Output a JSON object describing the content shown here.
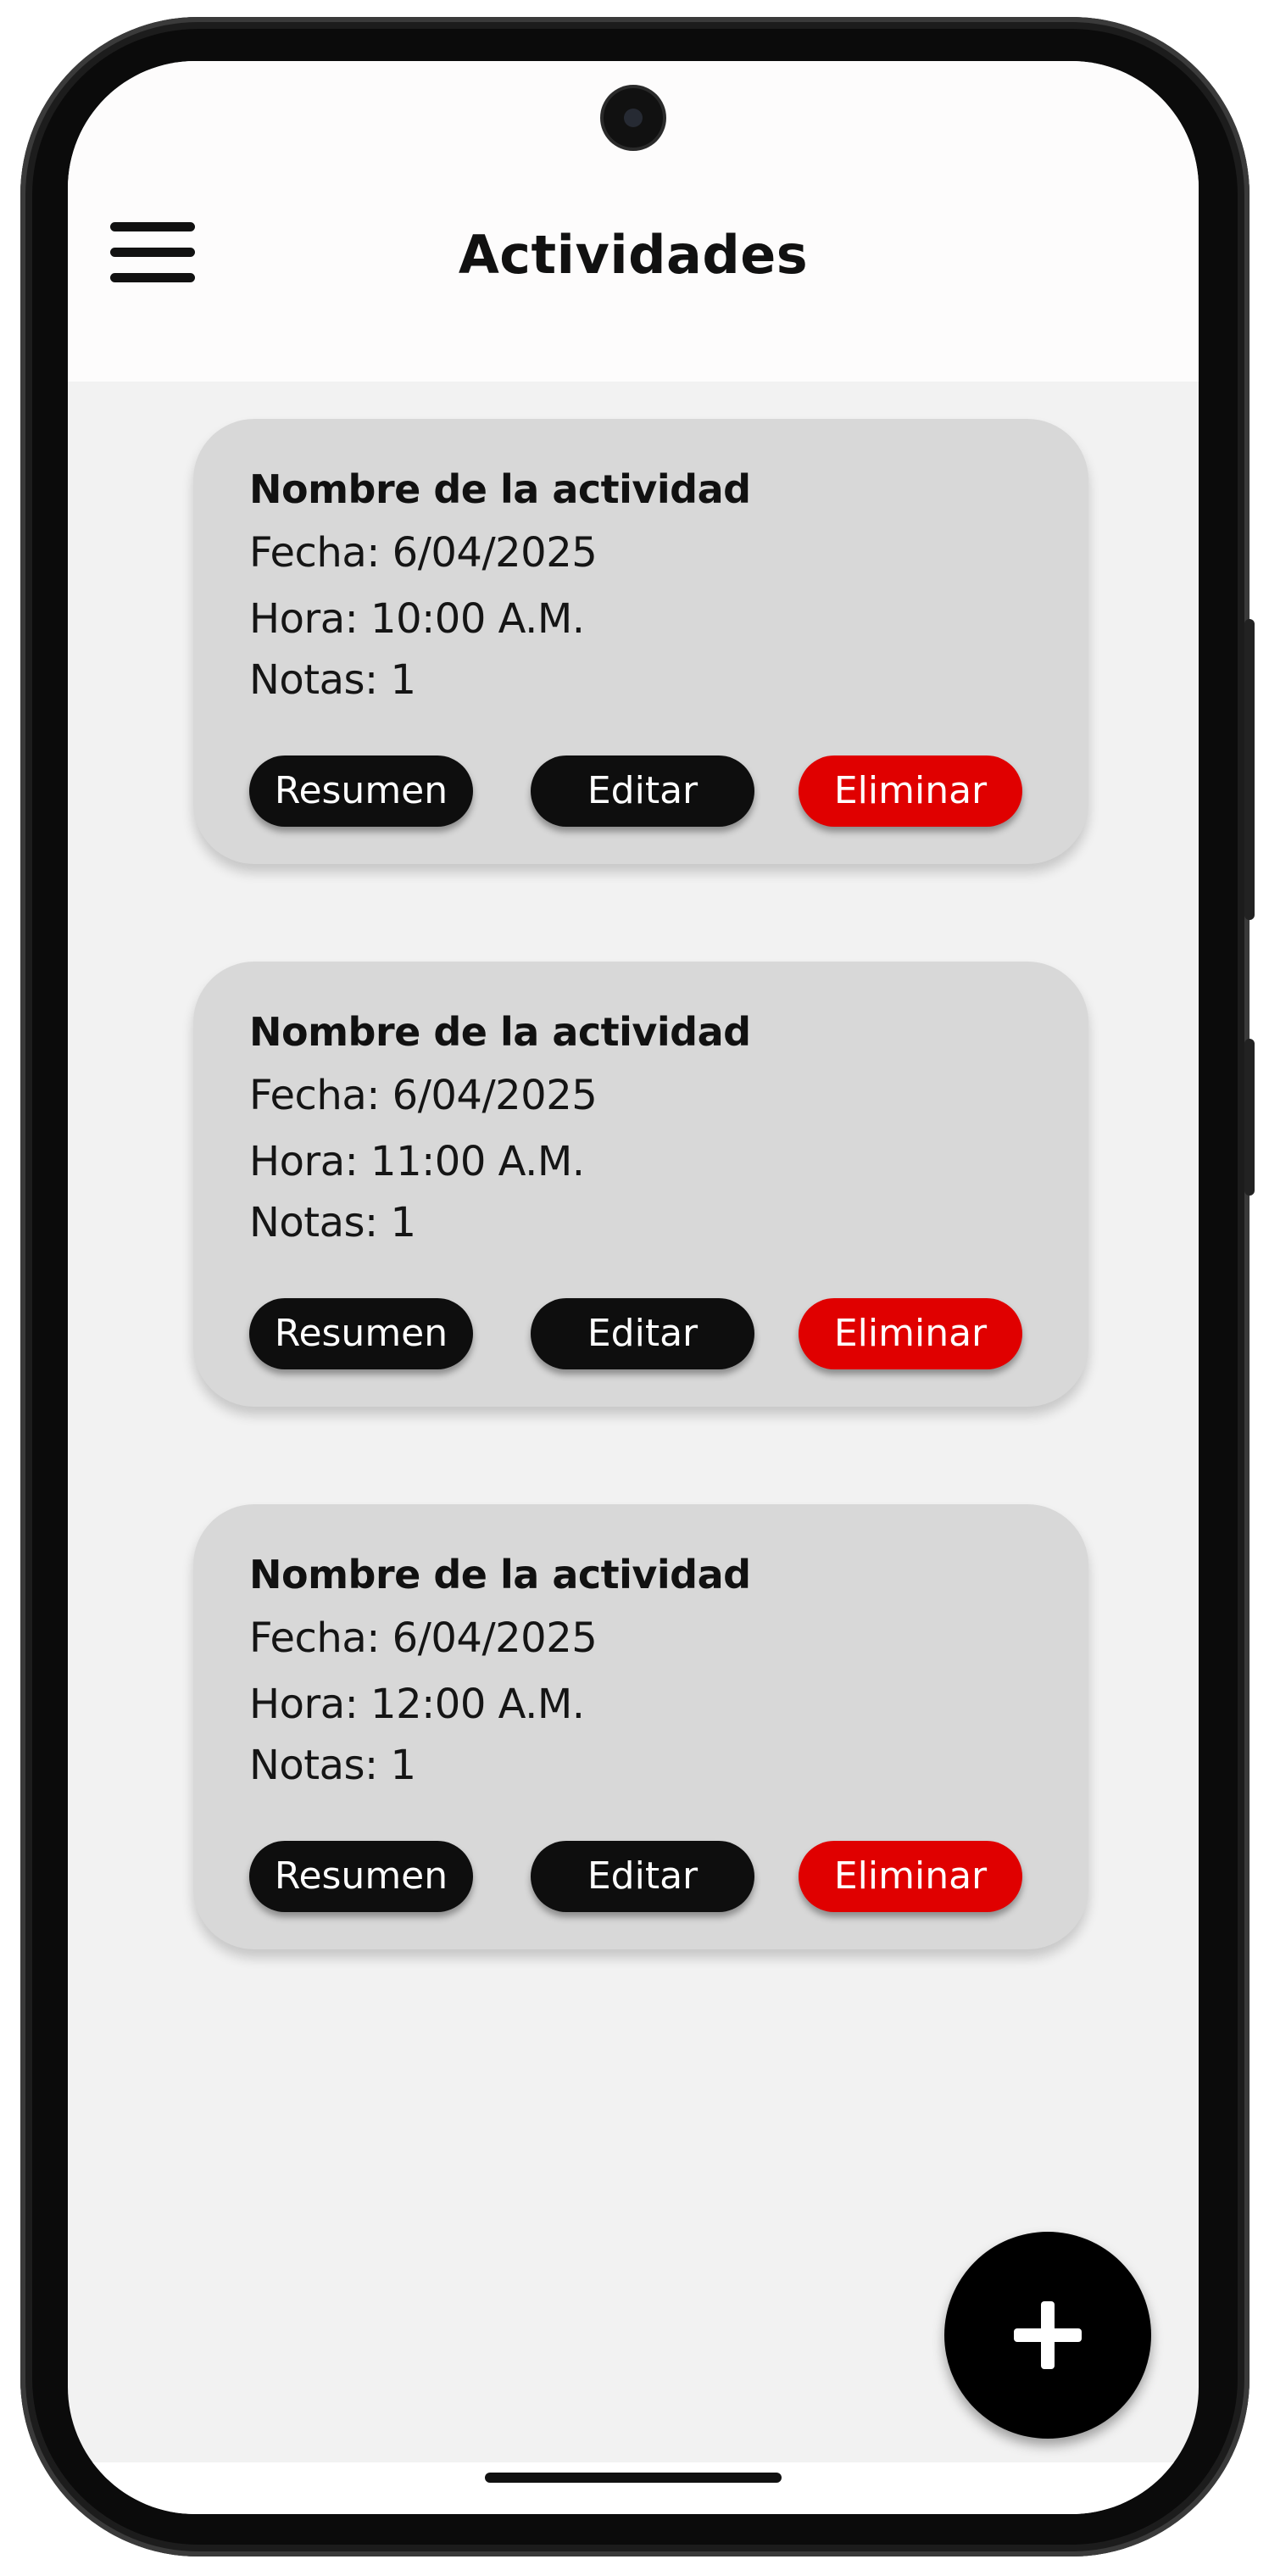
{
  "header": {
    "title": "Actividades",
    "menu_icon": "hamburger-menu-icon"
  },
  "activities": [
    {
      "name": "Nombre de la actividad",
      "date": "Fecha: 6/04/2025",
      "time": "Hora: 10:00 A.M.",
      "notes": "Notas: 1",
      "actions": {
        "summary": "Resumen",
        "edit": "Editar",
        "delete": "Eliminar"
      }
    },
    {
      "name": "Nombre de la actividad",
      "date": "Fecha: 6/04/2025",
      "time": "Hora: 11:00 A.M.",
      "notes": "Notas: 1",
      "actions": {
        "summary": "Resumen",
        "edit": "Editar",
        "delete": "Eliminar"
      }
    },
    {
      "name": "Nombre de la actividad",
      "date": "Fecha: 6/04/2025",
      "time": "Hora: 12:00 A.M.",
      "notes": "Notas: 1",
      "actions": {
        "summary": "Resumen",
        "edit": "Editar",
        "delete": "Eliminar"
      }
    }
  ],
  "fab": {
    "icon": "plus-icon"
  },
  "colors": {
    "card_background": "#d8d8d8",
    "primary_button": "#0e0e0e",
    "danger_button": "#e00000",
    "screen_background": "#f2f2f2"
  }
}
